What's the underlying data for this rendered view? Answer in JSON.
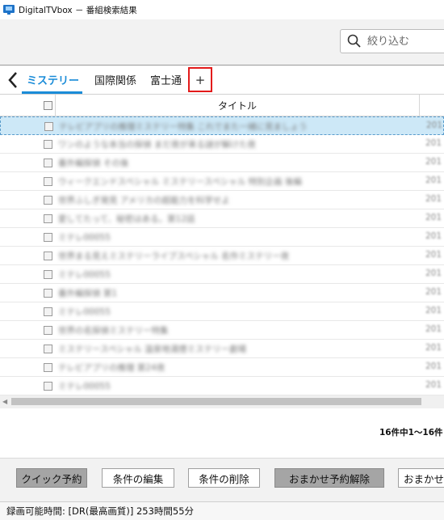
{
  "window": {
    "title": "DigitalTVbox － 番組検索結果"
  },
  "search": {
    "placeholder": "絞り込む"
  },
  "tabs": [
    {
      "label": "ミステリー",
      "active": true
    },
    {
      "label": "国際関係",
      "active": false
    },
    {
      "label": "富士通",
      "active": false
    }
  ],
  "tab_add_label": "+",
  "table": {
    "header_title": "タイトル",
    "rows": [
      {
        "title": "テレビアプリの推理ミステリー特集 これでまた一緒に見ましょう",
        "year": "201"
      },
      {
        "title": "ワンのような本当の探偵 まだ夜が来る謎が解けた夜",
        "year": "201"
      },
      {
        "title": "番外編探偵 その後",
        "year": "201"
      },
      {
        "title": "ウィークエンドスペシャル ミステリースペシャル 特別企画 後編",
        "year": "201"
      },
      {
        "title": "世界ふしぎ発見 アメリカの超能力を科学せよ",
        "year": "201"
      },
      {
        "title": "愛してたって、秘密はある。第12話",
        "year": "201"
      },
      {
        "title": "ミテレ00055",
        "year": "201"
      },
      {
        "title": "世界まる見えミステリーライブスペシャル 名作ミステリー夜",
        "year": "201"
      },
      {
        "title": "ミテレ00055",
        "year": "201"
      },
      {
        "title": "番外編探偵 第1",
        "year": "201"
      },
      {
        "title": "ミテレ00055",
        "year": "201"
      },
      {
        "title": "世界の名探偵ミステリー特集",
        "year": "201"
      },
      {
        "title": "ミステリースペシャル 温泉地湯煙ミステリー劇場",
        "year": "201"
      },
      {
        "title": "テレビアプリの推理 第24夜",
        "year": "201"
      },
      {
        "title": "ミテレ00055",
        "year": "201"
      }
    ]
  },
  "count_label": "16件中1～16件",
  "buttons": {
    "quick_reserve": "クイック予約",
    "edit_condition": "条件の編集",
    "delete_condition": "条件の削除",
    "cancel_auto_reserve": "おまかせ予約解除",
    "auto_cut": "おまかせ"
  },
  "status": {
    "recording_time": "録画可能時間: [DR(最高画質)] 253時間55分"
  },
  "colors": {
    "accent": "#1a8cd8",
    "highlight_box": "#e31b1b",
    "selected_row": "#cde8f7"
  }
}
